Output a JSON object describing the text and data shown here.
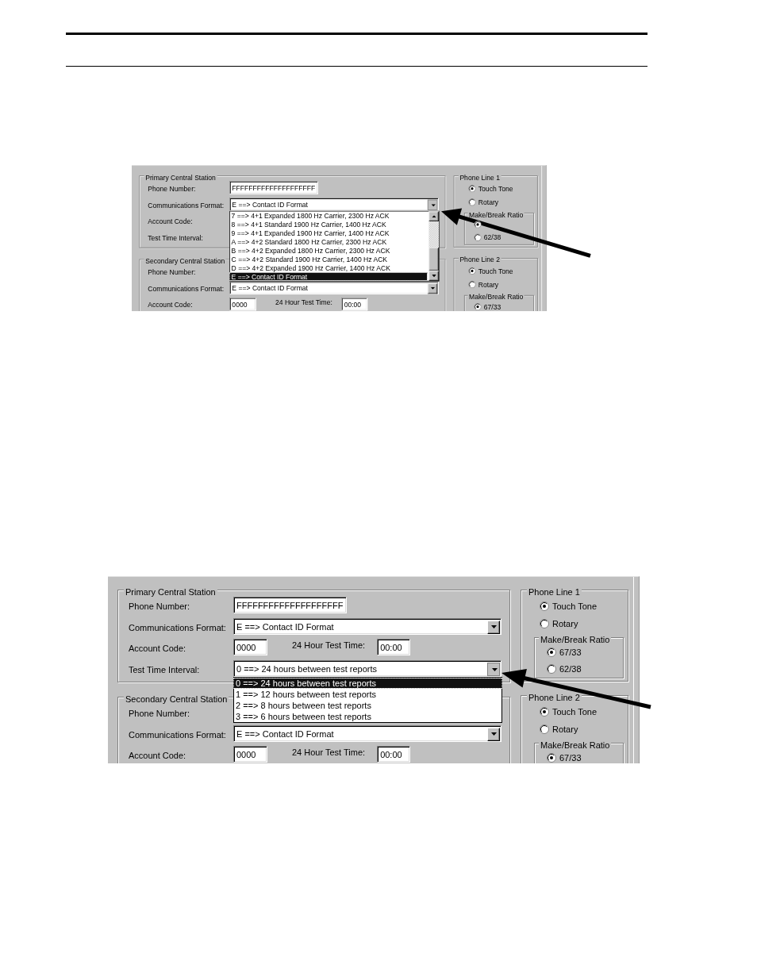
{
  "figures": [
    {
      "stations": [
        {
          "title": "Primary Central Station",
          "rows": [
            {
              "kind": "text",
              "label": "Phone Number:",
              "value": "FFFFFFFFFFFFFFFFFFFF"
            },
            {
              "kind": "combo",
              "label": "Communications Format:",
              "value": "E ==> Contact ID Format",
              "expanded": true,
              "scrollbar": true,
              "options": [
                {
                  "label": "7 ==> 4+1 Expanded 1800 Hz Carrier, 2300 Hz ACK",
                  "selected": false
                },
                {
                  "label": "8 ==> 4+1 Standard 1900 Hz Carrier, 1400 Hz ACK",
                  "selected": false
                },
                {
                  "label": "9 ==> 4+1 Expanded 1900 Hz Carrier, 1400 Hz ACK",
                  "selected": false
                },
                {
                  "label": "A ==> 4+2 Standard 1800 Hz Carrier, 2300 Hz ACK",
                  "selected": false
                },
                {
                  "label": "B ==> 4+2 Expanded 1800 Hz Carrier, 2300 Hz ACK",
                  "selected": false
                },
                {
                  "label": "C ==> 4+2 Standard 1900 Hz Carrier, 1400 Hz ACK",
                  "selected": false
                },
                {
                  "label": "D ==> 4+2 Expanded 1900 Hz Carrier, 1400 Hz ACK",
                  "selected": false
                },
                {
                  "label": "E ==> Contact ID Format",
                  "selected": true
                }
              ]
            },
            {
              "label": "Account Code:"
            },
            {
              "label": "Test Time Interval:"
            }
          ]
        },
        {
          "title": "Secondary Central Station",
          "rows": [
            {
              "label": "Phone Number:"
            },
            {
              "kind": "combo",
              "label": "Communications Format:",
              "value": "E ==> Contact ID Format",
              "expanded": false
            },
            {
              "kind": "text",
              "label": "Account Code:",
              "value": "0000",
              "extra": {
                "label": "24 Hour Test Time:",
                "value": "00:00"
              }
            }
          ]
        }
      ],
      "phone_lines": [
        {
          "title": "Phone Line 1",
          "dialing": [
            {
              "label": "Touch Tone",
              "selected": true
            },
            {
              "label": "Rotary",
              "selected": false
            }
          ],
          "ratio": {
            "title": "Make/Break Ratio",
            "options": [
              {
                "selected": true
              },
              {
                "label": "62/38",
                "selected": false
              }
            ]
          }
        },
        {
          "title": "Phone Line 2",
          "dialing": [
            {
              "label": "Touch Tone",
              "selected": true
            },
            {
              "label": "Rotary",
              "selected": false
            }
          ],
          "ratio": {
            "title": "Make/Break Ratio",
            "options": [
              {
                "label": "67/33",
                "selected": true
              }
            ]
          }
        }
      ]
    },
    {
      "stations": [
        {
          "title": "Primary Central Station",
          "rows": [
            {
              "kind": "text",
              "label": "Phone Number:",
              "value": "FFFFFFFFFFFFFFFFFFFF"
            },
            {
              "kind": "combo",
              "label": "Communications Format:",
              "value": "E ==> Contact ID Format",
              "expanded": false
            },
            {
              "kind": "text",
              "label": "Account Code:",
              "value": "0000",
              "extra": {
                "label": "24 Hour Test Time:",
                "value": "00:00"
              }
            },
            {
              "kind": "combo",
              "label": "Test Time Interval:",
              "value": "0 ==> 24 hours between test reports",
              "expanded": true,
              "scrollbar": false,
              "options": [
                {
                  "label": "0 ==> 24 hours between test reports",
                  "selected": true
                },
                {
                  "label": "1 ==> 12 hours between test reports",
                  "selected": false
                },
                {
                  "label": "2 ==> 8 hours between test reports",
                  "selected": false
                },
                {
                  "label": "3 ==> 6 hours between test reports",
                  "selected": false
                }
              ]
            }
          ]
        },
        {
          "title": "Secondary Central Station",
          "rows": [
            {
              "label": "Phone Number:"
            },
            {
              "kind": "combo",
              "label": "Communications Format:",
              "value": "E ==> Contact ID Format",
              "expanded": false
            },
            {
              "kind": "text",
              "label": "Account Code:",
              "value": "0000",
              "extra": {
                "label": "24 Hour Test Time:",
                "value": "00:00"
              }
            }
          ]
        }
      ],
      "phone_lines": [
        {
          "title": "Phone Line 1",
          "dialing": [
            {
              "label": "Touch Tone",
              "selected": true
            },
            {
              "label": "Rotary",
              "selected": false
            }
          ],
          "ratio": {
            "title": "Make/Break Ratio",
            "options": [
              {
                "label": "67/33",
                "selected": true
              },
              {
                "label": "62/38",
                "selected": false
              }
            ]
          }
        },
        {
          "title": "Phone Line 2",
          "dialing": [
            {
              "label": "Touch Tone",
              "selected": true
            },
            {
              "label": "Rotary",
              "selected": false
            }
          ],
          "ratio": {
            "title": "Make/Break Ratio",
            "options": [
              {
                "label": "67/33",
                "selected": true
              }
            ]
          }
        }
      ]
    }
  ]
}
